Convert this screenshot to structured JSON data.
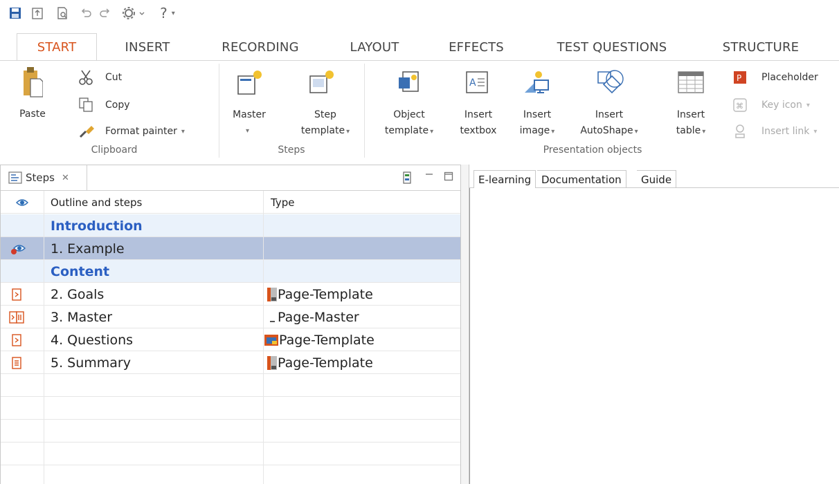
{
  "tabs": [
    "START",
    "INSERT",
    "RECORDING",
    "LAYOUT",
    "EFFECTS",
    "TEST QUESTIONS",
    "STRUCTURE"
  ],
  "active_tab": "START",
  "qat": {
    "help_label": "?"
  },
  "clipboard": {
    "paste": "Paste",
    "cut": "Cut",
    "copy": "Copy",
    "format_painter": "Format painter",
    "group": "Clipboard"
  },
  "steps_group": {
    "master": "Master",
    "step_line1": "Step",
    "step_line2": "template",
    "group": "Steps"
  },
  "presentation": {
    "object_line1": "Object",
    "object_line2": "template",
    "textbox_line1": "Insert",
    "textbox_line2": "textbox",
    "image_line1": "Insert",
    "image_line2": "image",
    "autoshape_line1": "Insert",
    "autoshape_line2": "AutoShape",
    "table_line1": "Insert",
    "table_line2": "table",
    "placeholder": "Placeholder",
    "key_icon": "Key icon",
    "insert_link": "Insert link",
    "group": "Presentation objects"
  },
  "panel": {
    "title": "Steps",
    "col_outline": "Outline and steps",
    "col_type": "Type",
    "rows": [
      {
        "label": "Introduction",
        "kind": "chapter",
        "type": ""
      },
      {
        "label": "1. Example",
        "kind": "selected",
        "type": ""
      },
      {
        "label": "Content",
        "kind": "chapter",
        "type": ""
      },
      {
        "label": "2. Goals",
        "kind": "step",
        "type": "Page-Template"
      },
      {
        "label": "3. Master",
        "kind": "master",
        "type": "Page-Master"
      },
      {
        "label": "4. Questions",
        "kind": "step",
        "type": "Page-Template"
      },
      {
        "label": "5. Summary",
        "kind": "step",
        "type": "Page-Template"
      }
    ]
  },
  "preview_tabs": [
    "E-learning",
    "Documentation",
    "Guide"
  ],
  "colors": {
    "accent": "#d8531c",
    "chapter_text": "#2b5fc2",
    "chapter_bg": "#eaf2fb",
    "selected_bg": "#b4c2dd"
  }
}
